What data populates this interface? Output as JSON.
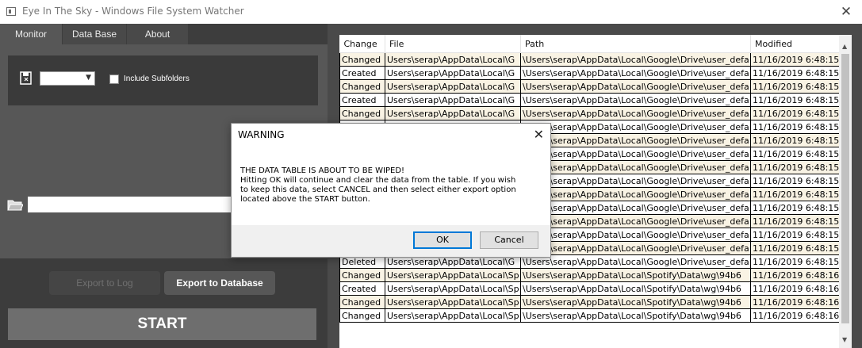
{
  "window": {
    "title": "Eye In The Sky - Windows File System Watcher",
    "close_icon": "close-icon"
  },
  "tabs": [
    {
      "label": "Monitor",
      "active": true
    },
    {
      "label": "Data Base",
      "active": false
    },
    {
      "label": "About",
      "active": false
    }
  ],
  "monitor": {
    "drive_value": "",
    "include_subfolders_label": "Include Subfolders",
    "include_subfolders_checked": false,
    "path_value": ""
  },
  "actions": {
    "export_log_label": "Export to Log",
    "export_db_label": "Export to Database",
    "start_label": "START"
  },
  "grid": {
    "columns": [
      "Change",
      "File",
      "Path",
      "Modified"
    ],
    "rows": [
      {
        "change": "Changed",
        "file": "Users\\serap\\AppData\\Local\\G",
        "path": "\\Users\\serap\\AppData\\Local\\Google\\Drive\\user_defa",
        "modified": "11/16/2019 6:48:15"
      },
      {
        "change": "Created",
        "file": "Users\\serap\\AppData\\Local\\G",
        "path": "\\Users\\serap\\AppData\\Local\\Google\\Drive\\user_defa",
        "modified": "11/16/2019 6:48:15"
      },
      {
        "change": "Changed",
        "file": "Users\\serap\\AppData\\Local\\G",
        "path": "\\Users\\serap\\AppData\\Local\\Google\\Drive\\user_defa",
        "modified": "11/16/2019 6:48:15"
      },
      {
        "change": "Created",
        "file": "Users\\serap\\AppData\\Local\\G",
        "path": "\\Users\\serap\\AppData\\Local\\Google\\Drive\\user_defa",
        "modified": "11/16/2019 6:48:15"
      },
      {
        "change": "Changed",
        "file": "Users\\serap\\AppData\\Local\\G",
        "path": "\\Users\\serap\\AppData\\Local\\Google\\Drive\\user_defa",
        "modified": "11/16/2019 6:48:15"
      },
      {
        "change": "",
        "file": "",
        "path": "\\Users\\serap\\AppData\\Local\\Google\\Drive\\user_defa",
        "modified": "11/16/2019 6:48:15"
      },
      {
        "change": "",
        "file": "",
        "path": "\\Users\\serap\\AppData\\Local\\Google\\Drive\\user_defa",
        "modified": "11/16/2019 6:48:15"
      },
      {
        "change": "",
        "file": "",
        "path": "\\Users\\serap\\AppData\\Local\\Google\\Drive\\user_defa",
        "modified": "11/16/2019 6:48:15"
      },
      {
        "change": "",
        "file": "",
        "path": "\\Users\\serap\\AppData\\Local\\Google\\Drive\\user_defa",
        "modified": "11/16/2019 6:48:15"
      },
      {
        "change": "",
        "file": "",
        "path": "\\Users\\serap\\AppData\\Local\\Google\\Drive\\user_defa",
        "modified": "11/16/2019 6:48:15"
      },
      {
        "change": "",
        "file": "",
        "path": "\\Users\\serap\\AppData\\Local\\Google\\Drive\\user_defa",
        "modified": "11/16/2019 6:48:15"
      },
      {
        "change": "",
        "file": "",
        "path": "\\Users\\serap\\AppData\\Local\\Google\\Drive\\user_defa",
        "modified": "11/16/2019 6:48:15"
      },
      {
        "change": "",
        "file": "",
        "path": "\\Users\\serap\\AppData\\Local\\Google\\Drive\\user_defa",
        "modified": "11/16/2019 6:48:15"
      },
      {
        "change": "",
        "file": "",
        "path": "\\Users\\serap\\AppData\\Local\\Google\\Drive\\user_defa",
        "modified": "11/16/2019 6:48:15"
      },
      {
        "change": "",
        "file": "",
        "path": "\\Users\\serap\\AppData\\Local\\Google\\Drive\\user_defa",
        "modified": "11/16/2019 6:48:15"
      },
      {
        "change": "Deleted",
        "file": "Users\\serap\\AppData\\Local\\G",
        "path": "\\Users\\serap\\AppData\\Local\\Google\\Drive\\user_defa",
        "modified": "11/16/2019 6:48:15"
      },
      {
        "change": "Changed",
        "file": "Users\\serap\\AppData\\Local\\Sp",
        "path": "\\Users\\serap\\AppData\\Local\\Spotify\\Data\\wg\\94b6",
        "modified": "11/16/2019 6:48:16"
      },
      {
        "change": "Created",
        "file": "Users\\serap\\AppData\\Local\\Sp",
        "path": "\\Users\\serap\\AppData\\Local\\Spotify\\Data\\wg\\94b6",
        "modified": "11/16/2019 6:48:16"
      },
      {
        "change": "Changed",
        "file": "Users\\serap\\AppData\\Local\\Sp",
        "path": "\\Users\\serap\\AppData\\Local\\Spotify\\Data\\wg\\94b6",
        "modified": "11/16/2019 6:48:16"
      },
      {
        "change": "Changed",
        "file": "Users\\serap\\AppData\\Local\\Sp",
        "path": "\\Users\\serap\\AppData\\Local\\Spotify\\Data\\wg\\94b6",
        "modified": "11/16/2019 6:48:16"
      }
    ]
  },
  "dialog": {
    "title": "WARNING",
    "lines": [
      "THE DATA TABLE IS ABOUT TO BE WIPED!",
      "Hitting OK will continue and clear the data from the table. If you wish",
      "to keep this data, select CANCEL and then select either export option",
      "located above the START button."
    ],
    "ok_label": "OK",
    "cancel_label": "Cancel"
  },
  "colors": {
    "panel_dark": "#3c3c3c",
    "panel_mid": "#575757",
    "row_highlight": "#f9f3e4",
    "dialog_accent": "#0078d7"
  }
}
